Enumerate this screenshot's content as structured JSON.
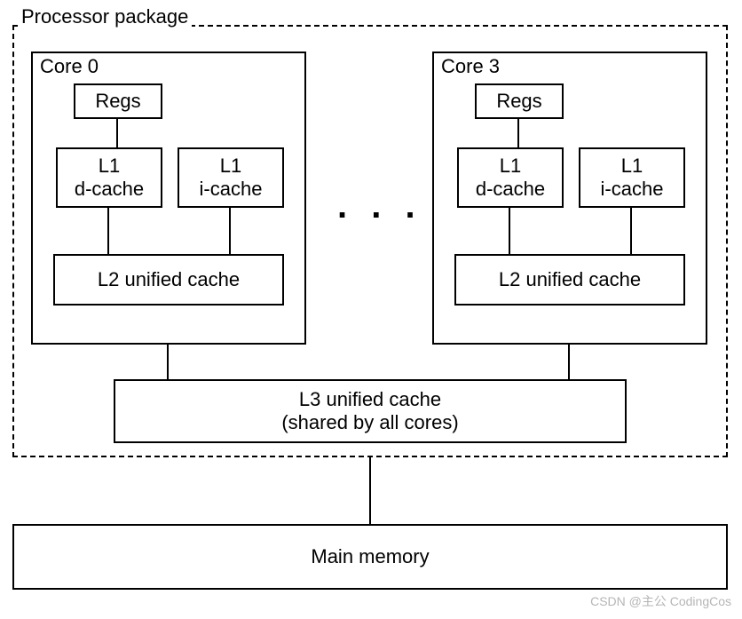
{
  "package_label": "Processor package",
  "cores": [
    {
      "label": "Core 0",
      "regs": "Regs",
      "l1d": "L1\nd-cache",
      "l1i": "L1\ni-cache",
      "l2": "L2 unified cache"
    },
    {
      "label": "Core 3",
      "regs": "Regs",
      "l1d": "L1\nd-cache",
      "l1i": "L1\ni-cache",
      "l2": "L2 unified cache"
    }
  ],
  "ellipsis": ". . .",
  "l3": {
    "line1": "L3 unified cache",
    "line2": "(shared by all cores)"
  },
  "main_memory": "Main memory",
  "watermark": "CSDN @主公 CodingCos"
}
